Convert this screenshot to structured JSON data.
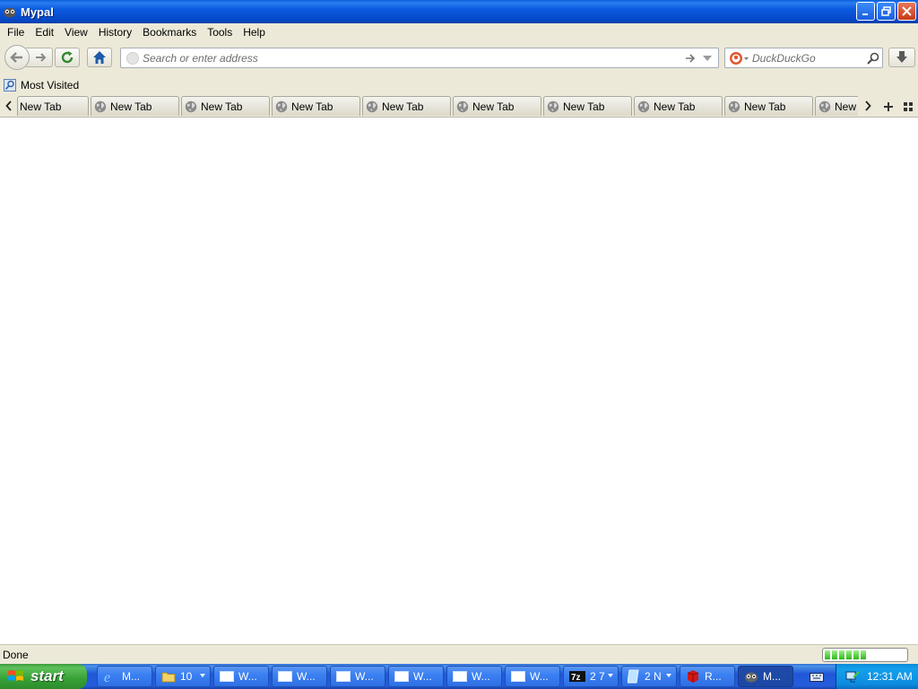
{
  "window": {
    "title": "Mypal"
  },
  "menu": [
    "File",
    "Edit",
    "View",
    "History",
    "Bookmarks",
    "Tools",
    "Help"
  ],
  "toolbar": {
    "address_placeholder": "Search or enter address",
    "search_placeholder": "DuckDuckGo"
  },
  "bookmarks": {
    "most_visited": "Most Visited"
  },
  "tabs": [
    "New Tab",
    "New Tab",
    "New Tab",
    "New Tab",
    "New Tab",
    "New Tab",
    "New Tab",
    "New Tab",
    "New Tab",
    "New"
  ],
  "status": {
    "text": "Done",
    "progress_segments": 6
  },
  "taskbar": {
    "start_label": "start",
    "buttons": [
      {
        "label": "M...",
        "icon": "ie-icon"
      },
      {
        "label": "10",
        "icon": "folder-icon"
      },
      {
        "label": "W...",
        "icon": "window-icon"
      },
      {
        "label": "W...",
        "icon": "window-icon"
      },
      {
        "label": "W...",
        "icon": "window-icon"
      },
      {
        "label": "W...",
        "icon": "window-icon"
      },
      {
        "label": "W...",
        "icon": "window-icon"
      },
      {
        "label": "W...",
        "icon": "window-icon"
      },
      {
        "label": "2 7",
        "icon": "7zip-icon"
      },
      {
        "label": "2 N",
        "icon": "notepad-icon"
      },
      {
        "label": "R...",
        "icon": "red-cube-icon"
      },
      {
        "label": "M...",
        "icon": "mypal-icon"
      }
    ],
    "clock": "12:31 AM"
  },
  "colors": {
    "titlebar": "#0a5ae0",
    "chrome": "#ece9d8",
    "taskbar": "#245ddb",
    "start": "#37a135",
    "tray": "#0d8ce0"
  }
}
